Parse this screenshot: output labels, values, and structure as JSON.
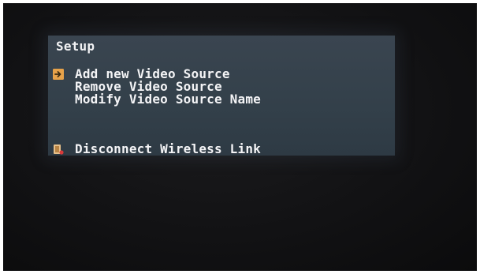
{
  "menu": {
    "title": "Setup",
    "items": [
      {
        "label": "Add new Video Source",
        "selected": true
      },
      {
        "label": "Remove Video Source",
        "selected": false
      },
      {
        "label": "Modify Video Source Name",
        "selected": false
      }
    ],
    "disconnect_label": "Disconnect Wireless Link"
  },
  "icons": {
    "selection": "arrow-right-icon",
    "disconnect": "door-exit-icon"
  },
  "colors": {
    "panel": "#36424c",
    "text": "#f4f4f6",
    "accent": "#e7a24a",
    "warning": "#d83a3a"
  }
}
